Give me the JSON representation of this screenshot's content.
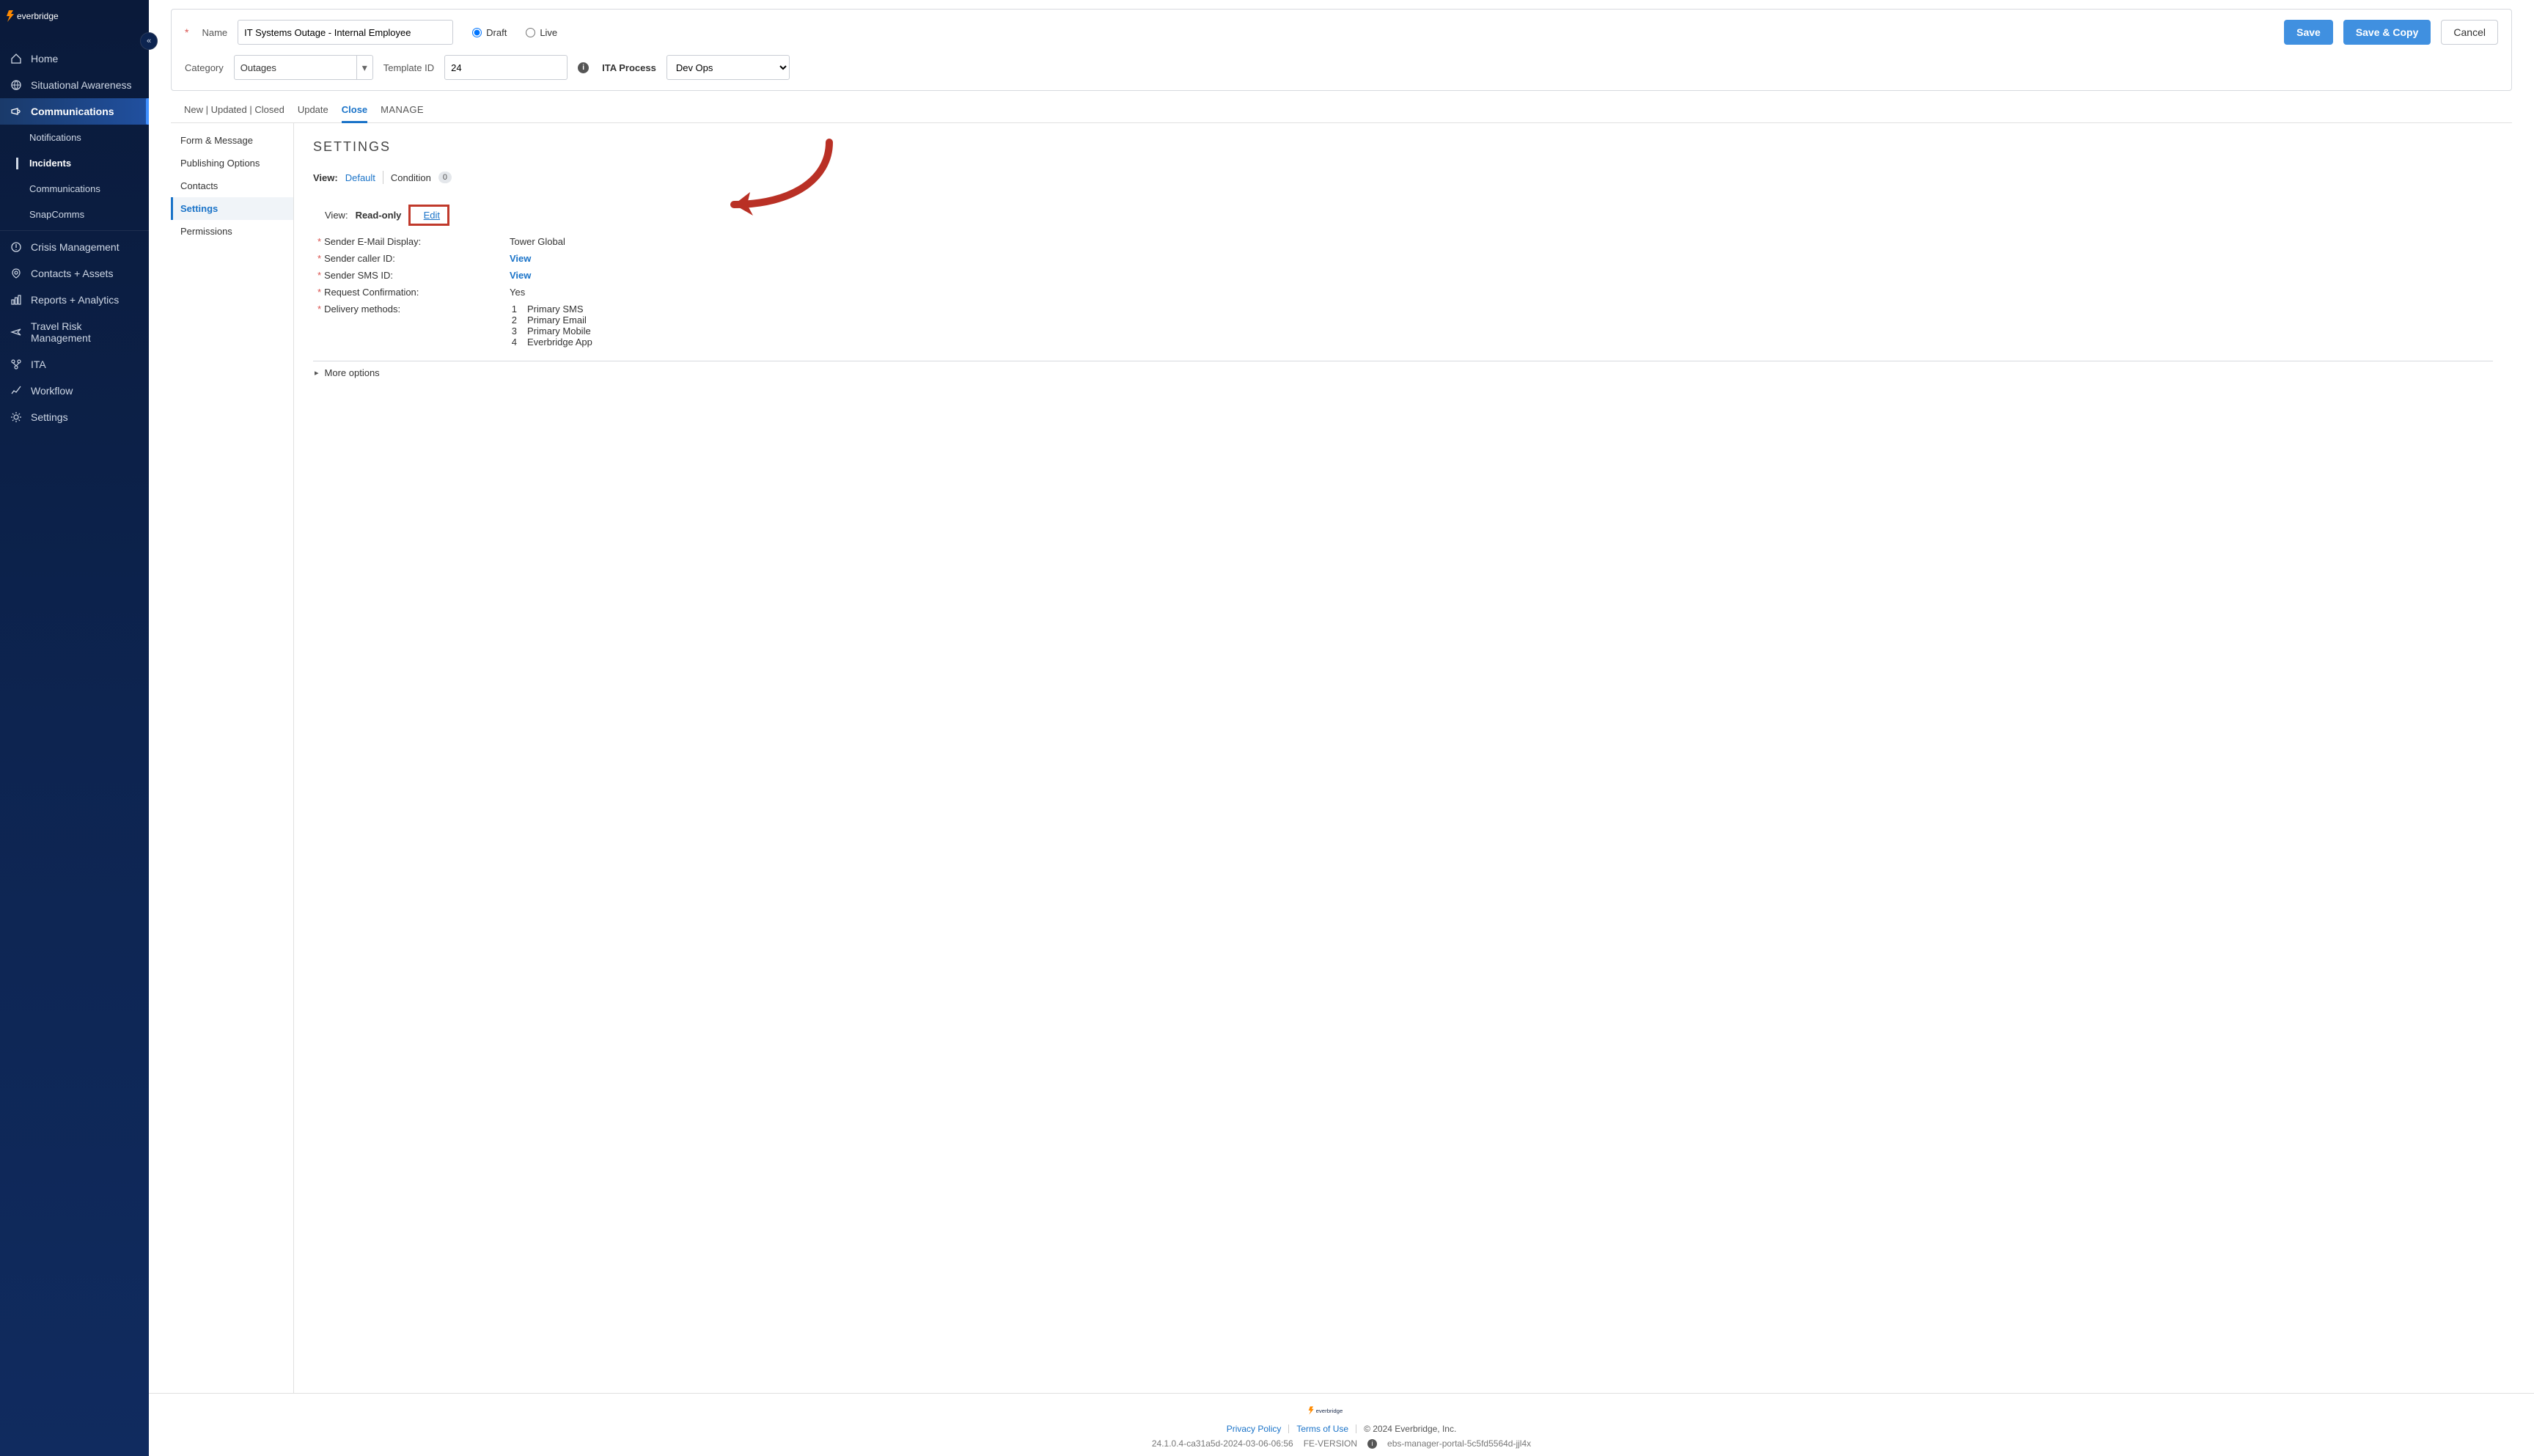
{
  "sidebar": {
    "items": [
      {
        "label": "Home"
      },
      {
        "label": "Situational Awareness"
      },
      {
        "label": "Communications"
      },
      {
        "label": "Notifications"
      },
      {
        "label": "Incidents"
      },
      {
        "label": "Communications"
      },
      {
        "label": "SnapComms"
      },
      {
        "label": "Crisis Management"
      },
      {
        "label": "Contacts + Assets"
      },
      {
        "label": "Reports + Analytics"
      },
      {
        "label": "Travel Risk Management"
      },
      {
        "label": "ITA"
      },
      {
        "label": "Workflow"
      },
      {
        "label": "Settings"
      }
    ]
  },
  "topbar": {
    "name_label": "Name",
    "name_value": "IT Systems Outage - Internal Employee",
    "draft_label": "Draft",
    "live_label": "Live",
    "save_label": "Save",
    "save_copy_label": "Save & Copy",
    "cancel_label": "Cancel",
    "category_label": "Category",
    "category_value": "Outages",
    "template_id_label": "Template ID",
    "template_id_value": "24",
    "ita_process_label": "ITA Process",
    "ita_process_value": "Dev Ops"
  },
  "tabs": {
    "t0": "New | Updated | Closed",
    "t1": "Update",
    "t2": "Close",
    "t3": "MANAGE"
  },
  "leftnav": {
    "i0": "Form & Message",
    "i1": "Publishing Options",
    "i2": "Contacts",
    "i3": "Settings",
    "i4": "Permissions"
  },
  "settings": {
    "title": "SETTINGS",
    "view_label": "View:",
    "default_label": "Default",
    "condition_label": "Condition",
    "condition_count": "0",
    "viewmode_label": "View:",
    "viewmode_value": "Read-only",
    "edit_label": "Edit",
    "rows": {
      "sender_email_label": "Sender E-Mail Display:",
      "sender_email_value": "Tower Global",
      "sender_caller_label": "Sender caller ID:",
      "sender_caller_value": "View",
      "sender_sms_label": "Sender SMS ID:",
      "sender_sms_value": "View",
      "request_conf_label": "Request Confirmation:",
      "request_conf_value": "Yes",
      "delivery_label": "Delivery methods:"
    },
    "delivery_methods": {
      "n1": "1",
      "v1": "Primary SMS",
      "n2": "2",
      "v2": "Primary Email",
      "n3": "3",
      "v3": "Primary Mobile",
      "n4": "4",
      "v4": "Everbridge App"
    },
    "more_options": "More options"
  },
  "footer": {
    "privacy": "Privacy Policy",
    "terms": "Terms of Use",
    "copyright": "© 2024 Everbridge, Inc.",
    "build": "24.1.0.4-ca31a5d-2024-03-06-06:56",
    "fe_version": "FE-VERSION",
    "pod": "ebs-manager-portal-5c5fd5564d-jjl4x"
  }
}
